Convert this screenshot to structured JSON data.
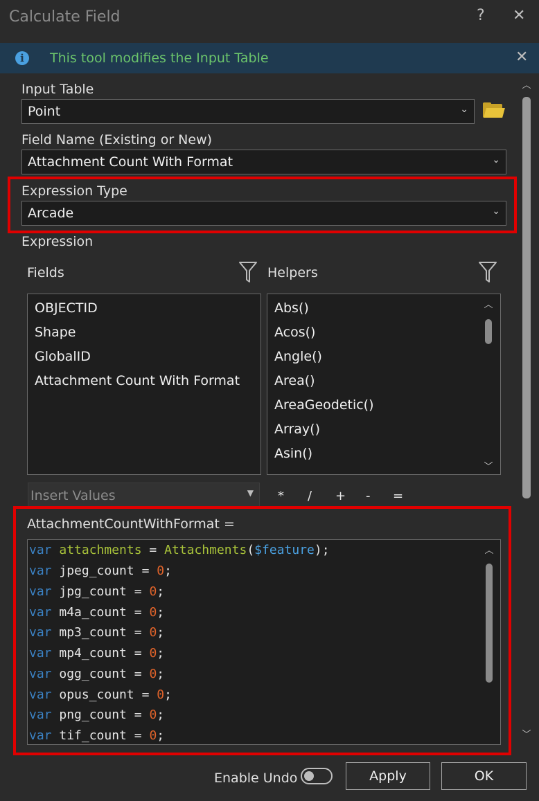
{
  "window": {
    "title": "Calculate Field",
    "help": "?",
    "close": "✕"
  },
  "info": {
    "icon": "i",
    "text": "This tool modifies the Input Table",
    "close": "✕"
  },
  "input_table": {
    "label": "Input Table",
    "value": "Point"
  },
  "field_name": {
    "label": "Field Name (Existing or New)",
    "value": "Attachment Count With Format"
  },
  "expression_type": {
    "label": "Expression Type",
    "value": "Arcade"
  },
  "expression": {
    "label": "Expression"
  },
  "fields": {
    "label": "Fields",
    "items": [
      "OBJECTID",
      "Shape",
      "GlobalID",
      "Attachment Count With Format"
    ]
  },
  "helpers": {
    "label": "Helpers",
    "items": [
      "Abs()",
      "Acos()",
      "Angle()",
      "Area()",
      "AreaGeodetic()",
      "Array()",
      "Asin()"
    ]
  },
  "insert_values": {
    "placeholder": "Insert Values"
  },
  "operators": [
    "*",
    "/",
    "+",
    "-",
    "="
  ],
  "code_header": "AttachmentCountWithFormat =",
  "code": {
    "line0": {
      "kw": "var",
      "name": "attachments",
      "eq": "=",
      "fn": "Attachments",
      "open": "(",
      "arg": "$feature",
      "close": ");"
    },
    "lines": [
      {
        "kw": "var",
        "name": "jpeg_count",
        "eq": "=",
        "num": "0",
        "end": ";"
      },
      {
        "kw": "var",
        "name": "jpg_count",
        "eq": "=",
        "num": "0",
        "end": ";"
      },
      {
        "kw": "var",
        "name": "m4a_count",
        "eq": "=",
        "num": "0",
        "end": ";"
      },
      {
        "kw": "var",
        "name": "mp3_count",
        "eq": "=",
        "num": "0",
        "end": ";"
      },
      {
        "kw": "var",
        "name": "mp4_count",
        "eq": "=",
        "num": "0",
        "end": ";"
      },
      {
        "kw": "var",
        "name": "ogg_count",
        "eq": "=",
        "num": "0",
        "end": ";"
      },
      {
        "kw": "var",
        "name": "opus_count",
        "eq": "=",
        "num": "0",
        "end": ";"
      },
      {
        "kw": "var",
        "name": "png_count",
        "eq": "=",
        "num": "0",
        "end": ";"
      },
      {
        "kw": "var",
        "name": "tif_count",
        "eq": "=",
        "num": "0",
        "end": ";"
      }
    ]
  },
  "footer": {
    "enable_undo": "Enable Undo",
    "apply": "Apply",
    "ok": "OK"
  },
  "colors": {
    "highlight": "#e00000",
    "info_text": "#6bc46b",
    "info_bg": "#1f3a50"
  },
  "icons": {
    "folder": "folder-open-icon",
    "filter": "filter-icon",
    "info": "info-icon"
  }
}
